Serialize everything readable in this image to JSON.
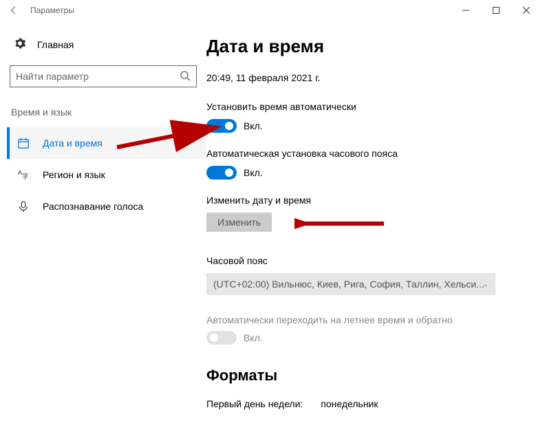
{
  "window": {
    "title": "Параметры"
  },
  "sidebar": {
    "home_label": "Главная",
    "search_placeholder": "Найти параметр",
    "category": "Время и язык",
    "items": [
      {
        "label": "Дата и время",
        "icon": "datetime-icon"
      },
      {
        "label": "Регион и язык",
        "icon": "region-icon"
      },
      {
        "label": "Распознавание голоса",
        "icon": "voice-icon"
      }
    ]
  },
  "main": {
    "heading": "Дата и время",
    "current_datetime": "20:49, 11 февраля 2021 г.",
    "auto_time_label": "Установить время автоматически",
    "auto_time_state": "Вкл.",
    "auto_tz_label": "Автоматическая установка часового пояса",
    "auto_tz_state": "Вкл.",
    "change_dt_label": "Изменить дату и время",
    "change_button": "Изменить",
    "timezone_label": "Часовой пояс",
    "timezone_value": "(UTC+02:00) Вильнюс, Киев, Рига, София, Таллин, Хельси...",
    "dst_label": "Автоматически переходить на летнее время и обратно",
    "dst_state": "Вкл.",
    "formats_heading": "Форматы",
    "first_day_label": "Первый день недели:",
    "first_day_value": "понедельник"
  }
}
